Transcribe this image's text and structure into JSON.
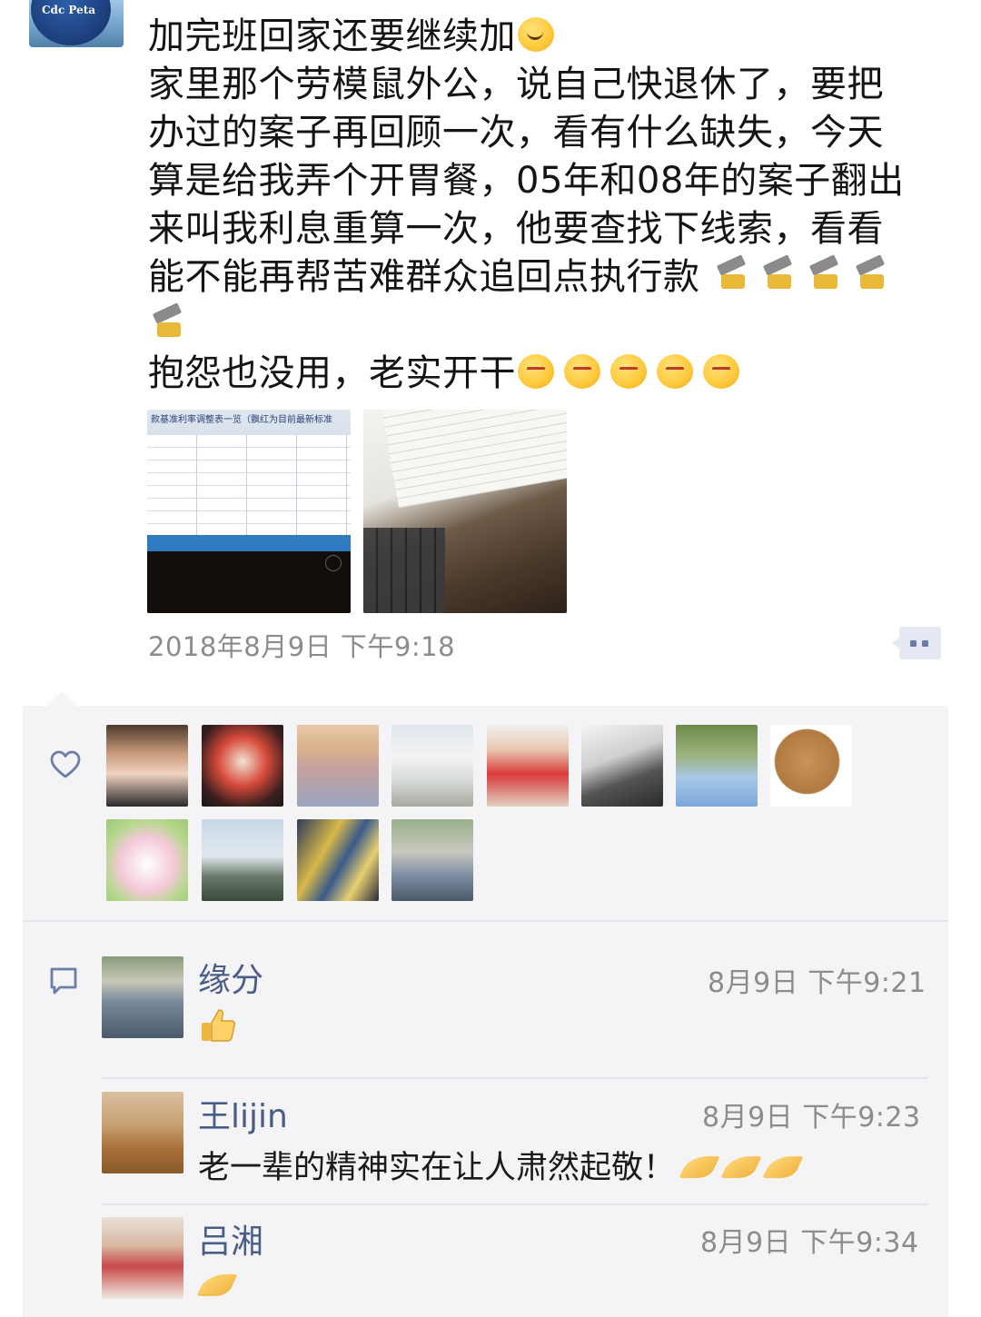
{
  "post": {
    "lines": [
      "加完班回家还要继续加",
      "家里那个劳模鼠外公，说自己快退休了，要把",
      "办过的案子再回顾一次，看有什么缺失，今天",
      "算是给我弄个开胃餐，05年和08年的案子翻出",
      "来叫我利息重算一次，他要查找下线索，看看",
      "能不能再帮苦难群众追回点执行款",
      "",
      "抱怨也没用，老实开干"
    ],
    "image1_header": "款基准利率调整表一览（飘红为目前最新标准",
    "timestamp": "2018年8月9日 下午9:18",
    "emoji": {
      "line1": "smirk-wink-emoji",
      "line6": "hammer-emoji",
      "line8": "angry-face-emoji"
    }
  },
  "likes": {
    "count": 12
  },
  "comments": [
    {
      "name": "缘分",
      "time": "8月9日 下午9:21",
      "text": "",
      "emoji": "thumbs-up-emoji"
    },
    {
      "name": "王lijin",
      "time": "8月9日 下午9:23",
      "text": "老一辈的精神实在让人肃然起敬！",
      "emoji": "salute-palm-emoji"
    },
    {
      "name": "吕湘",
      "time": "8月9日 下午9:34",
      "text": "",
      "emoji": "salute-palm-emoji"
    }
  ],
  "colors": {
    "panel_bg": "#f4f4f6",
    "name_blue": "#4a5d87",
    "timestamp_gray": "#8c8c8c",
    "icon_blue": "#6a7ea8"
  }
}
